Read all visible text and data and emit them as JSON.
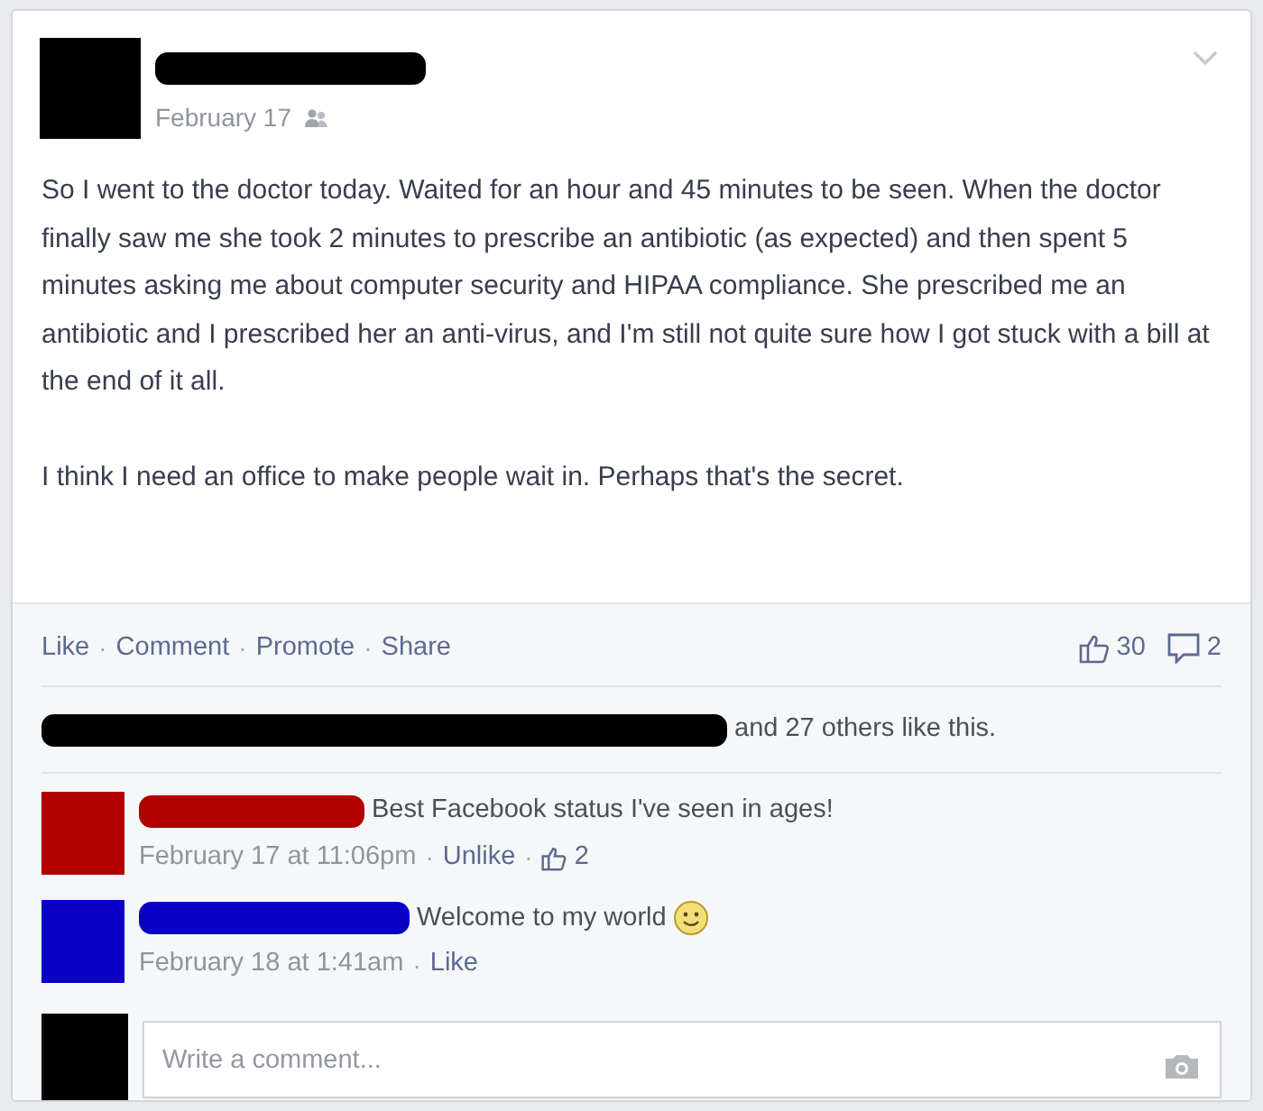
{
  "post": {
    "date": "February 17",
    "paragraphs": [
      "So I went to the doctor today. Waited for an hour and 45 minutes to be seen. When the doctor finally saw me she took 2 minutes to prescribe an antibiotic (as expected) and then spent 5 minutes asking me about computer security and HIPAA compliance. She prescribed me an antibiotic and I prescribed her an anti-virus, and I'm still not quite sure how I got stuck with a bill at the end of it all.",
      "I think I need an office to make people wait in. Perhaps that's the secret."
    ]
  },
  "separator": "·",
  "actions": [
    "Like",
    "Comment",
    "Promote",
    "Share"
  ],
  "like_count": "30",
  "comment_count": "2",
  "likes_summary": "and 27 others like this.",
  "comments": [
    {
      "color": "#b10000",
      "text": "Best Facebook status I've seen in ages!",
      "emoji": false,
      "time": "February 17 at 11:06pm",
      "action": "Unlike",
      "like_count": "2"
    },
    {
      "color": "#0a00c4",
      "text": "Welcome to my world",
      "emoji": true,
      "time": "February 18 at 1:41am",
      "action": "Like"
    }
  ],
  "comment_box": {
    "placeholder": "Write a comment..."
  }
}
